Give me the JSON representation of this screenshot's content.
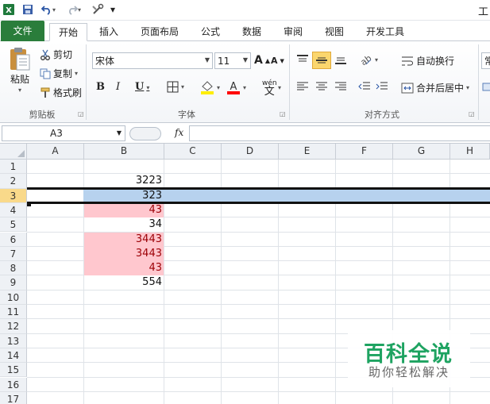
{
  "title": "工",
  "quick_access": {
    "save": "save-icon",
    "undo": "undo-icon",
    "redo": "redo-icon",
    "customize": "▾"
  },
  "tabs": [
    "文件",
    "开始",
    "插入",
    "页面布局",
    "公式",
    "数据",
    "审阅",
    "视图",
    "开发工具"
  ],
  "active_tab": "开始",
  "clipboard": {
    "paste": "粘贴",
    "cut": "剪切",
    "copy": "复制",
    "format_painter": "格式刷",
    "label": "剪贴板"
  },
  "font": {
    "name": "宋体",
    "size": "11",
    "grow": "A",
    "shrink": "A",
    "bold": "B",
    "italic": "I",
    "underline": "U",
    "phonetic": "wén",
    "label": "字体",
    "colors": {
      "highlight": "#ffee00",
      "font": "#ff0000"
    }
  },
  "alignment": {
    "wrap": "自动换行",
    "merge": "合并后居中",
    "label": "对齐方式"
  },
  "number": {
    "format": "常"
  },
  "formula_bar": {
    "name_box": "A3",
    "fx": "fx",
    "value": ""
  },
  "columns": [
    "A",
    "B",
    "C",
    "D",
    "E",
    "F",
    "G",
    "H"
  ],
  "rows": [
    "1",
    "2",
    "3",
    "4",
    "5",
    "6",
    "7",
    "8",
    "9",
    "10",
    "11",
    "12",
    "13",
    "14",
    "15",
    "16",
    "17"
  ],
  "selected_row": "3",
  "cells_b": [
    {
      "row": 2,
      "value": "3223",
      "highlight": false
    },
    {
      "row": 3,
      "value": "323",
      "highlight": false
    },
    {
      "row": 4,
      "value": "43",
      "highlight": true
    },
    {
      "row": 5,
      "value": "34",
      "highlight": false
    },
    {
      "row": 6,
      "value": "3443",
      "highlight": true
    },
    {
      "row": 7,
      "value": "3443",
      "highlight": true
    },
    {
      "row": 8,
      "value": "43",
      "highlight": true
    },
    {
      "row": 9,
      "value": "554",
      "highlight": false
    }
  ],
  "watermark": {
    "title": "百科全说",
    "subtitle": "助你轻松解决"
  }
}
